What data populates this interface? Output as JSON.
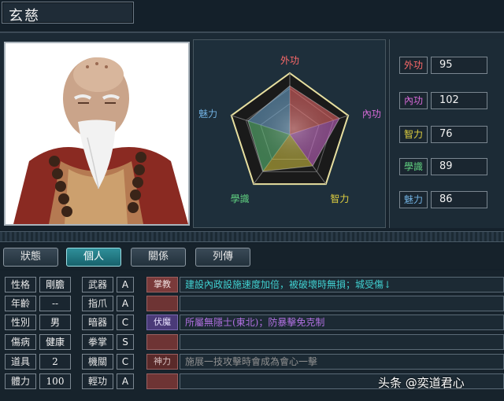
{
  "character": {
    "name": "玄慈"
  },
  "radar": {
    "axes": [
      "外功",
      "內功",
      "智力",
      "學識",
      "魅力"
    ],
    "values": [
      95,
      102,
      76,
      89,
      86
    ],
    "max": 120
  },
  "stats": [
    {
      "label": "外功",
      "value": "95",
      "color": "#ff6a6a"
    },
    {
      "label": "內功",
      "value": "102",
      "color": "#d86ad8"
    },
    {
      "label": "智力",
      "value": "76",
      "color": "#e0d040"
    },
    {
      "label": "學識",
      "value": "89",
      "color": "#60d080"
    },
    {
      "label": "魅力",
      "value": "86",
      "color": "#70b0e0"
    }
  ],
  "tabs": [
    {
      "label": "狀態"
    },
    {
      "label": "個人"
    },
    {
      "label": "關係"
    },
    {
      "label": "列傳"
    }
  ],
  "attributes": [
    {
      "label": "性格",
      "value": "剛膽"
    },
    {
      "label": "年齡",
      "value": "--"
    },
    {
      "label": "性別",
      "value": "男"
    },
    {
      "label": "傷病",
      "value": "健康"
    },
    {
      "label": "道具",
      "value": "2"
    },
    {
      "label": "體力",
      "value": "100"
    }
  ],
  "weapons": [
    {
      "label": "武器",
      "grade": "A"
    },
    {
      "label": "指爪",
      "grade": "A"
    },
    {
      "label": "暗器",
      "grade": "C"
    },
    {
      "label": "拳掌",
      "grade": "S"
    },
    {
      "label": "機關",
      "grade": "C"
    },
    {
      "label": "輕功",
      "grade": "A"
    }
  ],
  "skills": [
    {
      "name": "掌教",
      "desc": "建設內政設施速度加倍，被破壞時無損；城受傷↓",
      "desc_color": "#40d0d0"
    },
    {
      "name": "",
      "desc": "",
      "desc_color": "#e0e0e0"
    },
    {
      "name": "伏魔",
      "desc": "所屬無隱士(東北)；防暴擊免克制",
      "desc_color": "#b070e0"
    },
    {
      "name": "",
      "desc": "",
      "desc_color": "#e0e0e0"
    },
    {
      "name": "神力",
      "desc": "施展一技攻擊時會成為會心一擊",
      "desc_color": "#909090"
    },
    {
      "name": "",
      "desc": "",
      "desc_color": "#e0e0e0"
    }
  ],
  "watermark": "头条 @奕道君心",
  "colors": {
    "accent_tab": "#2f8f9a",
    "skill_red": "#7a3a3a",
    "skill_purple": "#4a3a78"
  }
}
